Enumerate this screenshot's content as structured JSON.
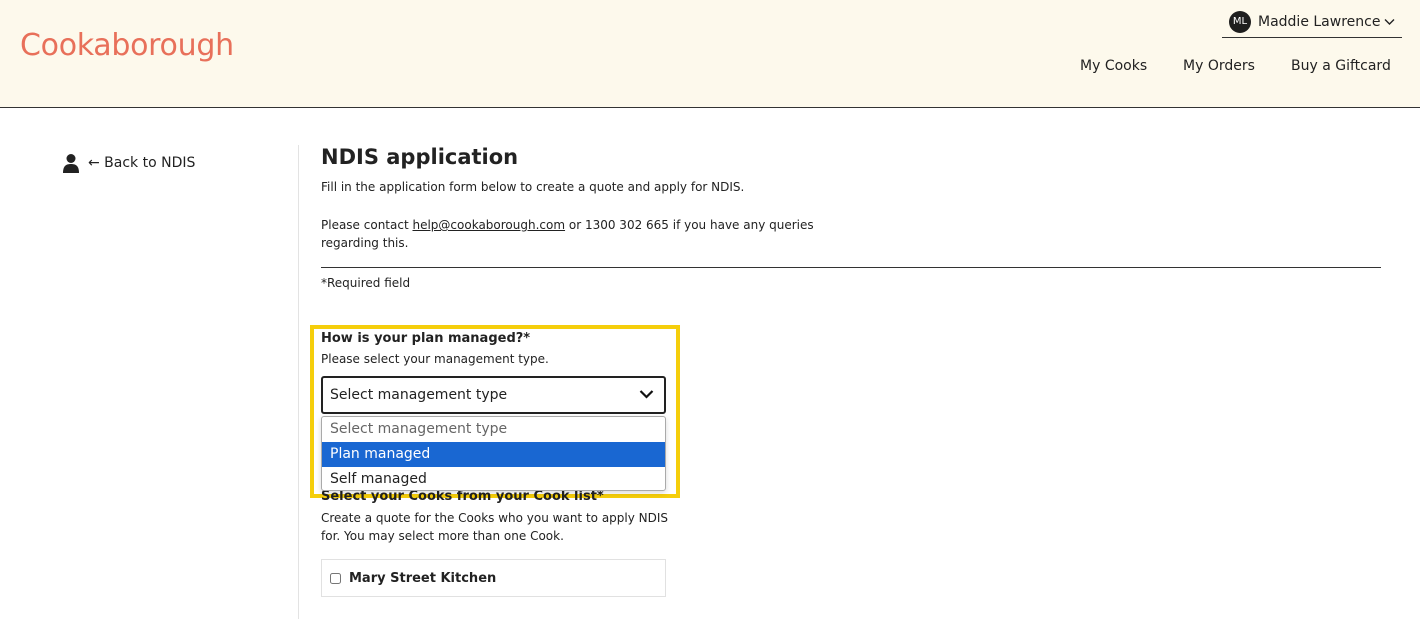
{
  "brand": {
    "logo_text": "Cookaborough",
    "color": "#e8705a"
  },
  "user": {
    "initials": "ML",
    "name": "Maddie Lawrence"
  },
  "nav": {
    "items": [
      "My Cooks",
      "My Orders",
      "Buy a Giftcard"
    ]
  },
  "sidebar": {
    "back_label": "← Back to NDIS"
  },
  "main": {
    "title": "NDIS application",
    "intro": "Fill in the application form below to create a quote and apply for NDIS.",
    "contact_prefix": "Please contact ",
    "contact_email": "help@cookaborough.com",
    "contact_suffix": " or 1300 302 665 if you have any queries regarding this.",
    "required_note": "*Required field"
  },
  "plan_question": {
    "label": "How is your plan managed?*",
    "help": "Please select your management type.",
    "selected_value": "Select management type",
    "options": [
      "Select management type",
      "Plan managed",
      "Self managed"
    ],
    "highlighted_option": "Plan managed"
  },
  "cooks_question": {
    "label": "Select your Cooks from your Cook list*",
    "help": "Create a quote for the Cooks who you want to apply NDIS for. You may select more than one Cook.",
    "cooks": [
      {
        "name": "Mary Street Kitchen",
        "checked": false
      }
    ]
  },
  "colors": {
    "header_bg": "#fdf9ec",
    "highlight": "#f5ce0b",
    "option_selected": "#1967d2"
  }
}
